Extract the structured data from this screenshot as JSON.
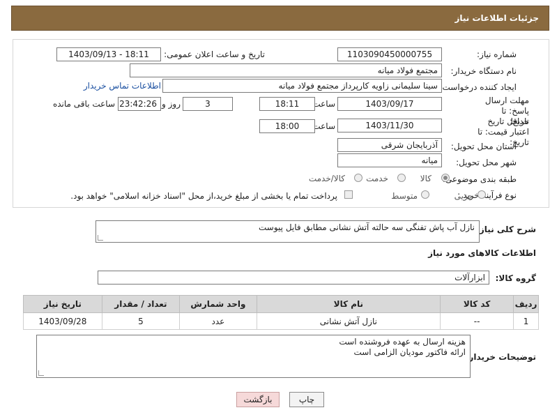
{
  "header": {
    "title": "جزئیات اطلاعات نیاز"
  },
  "form": {
    "need_number_label": "شماره نیاز:",
    "need_number": "1103090450000755",
    "announce_label": "تاریخ و ساعت اعلان عمومی:",
    "announce_value": "1403/09/13 - 18:11",
    "buyer_label": "نام دستگاه خریدار:",
    "buyer_value": "مجتمع فولاد میانه",
    "creator_label": "ایجاد کننده درخواست:",
    "creator_value": "سینا سلیمانی زاویه کارپرداز مجتمع فولاد میانه",
    "contact_link": "اطلاعات تماس خریدار",
    "deadline_label": "مهلت ارسال پاسخ: تا تاریخ:",
    "deadline_date": "1403/09/17",
    "hour_label": "ساعت",
    "deadline_time": "18:11",
    "days_count": "3",
    "days_label": "روز و",
    "remaining_time": "23:42:26",
    "remaining_label": "ساعت باقی مانده",
    "validity_label": "حداقل تاریخ اعتبار قیمت: تا تاریخ:",
    "validity_date": "1403/11/30",
    "validity_time": "18:00",
    "province_label": "استان محل تحویل:",
    "province_value": "آذربایجان شرقی",
    "city_label": "شهر محل تحویل:",
    "city_value": "میانه",
    "category_label": "طبقه بندی موضوعی:",
    "category_options": [
      "کالا",
      "خدمت",
      "کالا/خدمت"
    ],
    "process_label": "نوع فرآیند خرید :",
    "process_options": [
      "جزیی",
      "متوسط"
    ],
    "payment_text": "پرداخت تمام یا بخشی از مبلغ خرید،از محل \"اسناد خزانه اسلامی\" خواهد بود."
  },
  "description": {
    "label": "شرح کلی نیاز:",
    "text": "نازل آب پاش تفنگی  سه حالته آتش نشانی مطابق فایل پیوست"
  },
  "goods": {
    "section_title": "اطلاعات کالاهای مورد نیاز",
    "group_label": "گروه کالا:",
    "group_value": "ابزارآلات",
    "columns": [
      "ردیف",
      "کد کالا",
      "نام کالا",
      "واحد شمارش",
      "تعداد / مقدار",
      "تاریخ نیاز"
    ],
    "rows": [
      {
        "row": "1",
        "code": "--",
        "name": "نازل آتش نشانی",
        "unit": "عدد",
        "qty": "5",
        "date": "1403/09/28"
      }
    ]
  },
  "buyer_notes": {
    "label": "توضیحات خریدار:",
    "line1": "هزینه ارسال به عهده فروشنده است",
    "line2": "ارائه فاکتور مودیان الزامی است"
  },
  "buttons": {
    "print": "چاپ",
    "back": "بازگشت"
  },
  "colors": {
    "header_bg": "#8a6a3f",
    "link": "#1a4fa0",
    "back_bg": "#f6d9d9"
  }
}
